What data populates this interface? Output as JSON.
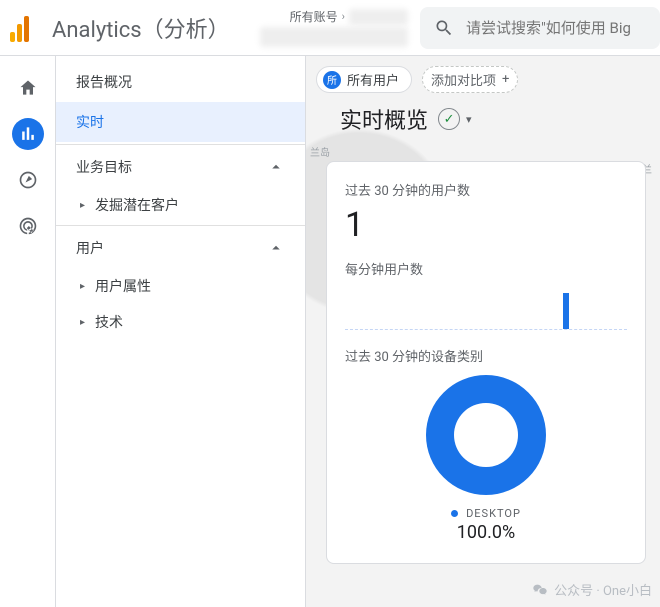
{
  "header": {
    "title": "Analytics（分析）",
    "breadcrumb_top": "所有账号",
    "search_placeholder": "请尝试搜索\"如何使用 Big"
  },
  "sidenav": {
    "overview": "报告概况",
    "realtime": "实时",
    "section_business": "业务目标",
    "item_potential": "发掘潜在客户",
    "section_users": "用户",
    "item_user_attr": "用户属性",
    "item_tech": "技术"
  },
  "chips": {
    "all_users_badge": "所",
    "all_users": "所有用户",
    "add_compare": "添加对比项"
  },
  "page": {
    "title": "实时概览"
  },
  "card": {
    "users_30m_label": "过去 30 分钟的用户数",
    "users_30m_value": "1",
    "per_min_label": "每分钟用户数",
    "devices_label": "过去 30 分钟的设备类别",
    "legend_desktop": "DESKTOP",
    "percent": "100.0%"
  },
  "map_labels": {
    "l1": "兰岛",
    "l2": "芬兰"
  },
  "watermark": "公众号 · One小白",
  "chart_data": [
    {
      "type": "bar",
      "title": "每分钟用户数",
      "categories_note": "last 30 one-minute buckets",
      "values": [
        0,
        0,
        0,
        0,
        0,
        0,
        0,
        0,
        0,
        0,
        0,
        0,
        0,
        0,
        0,
        0,
        0,
        0,
        0,
        0,
        0,
        0,
        0,
        0,
        1,
        0,
        0,
        0,
        0,
        0
      ],
      "ylim": [
        0,
        1
      ]
    },
    {
      "type": "pie",
      "title": "过去 30 分钟的设备类别",
      "series": [
        {
          "name": "DESKTOP",
          "value": 100.0
        }
      ]
    }
  ]
}
